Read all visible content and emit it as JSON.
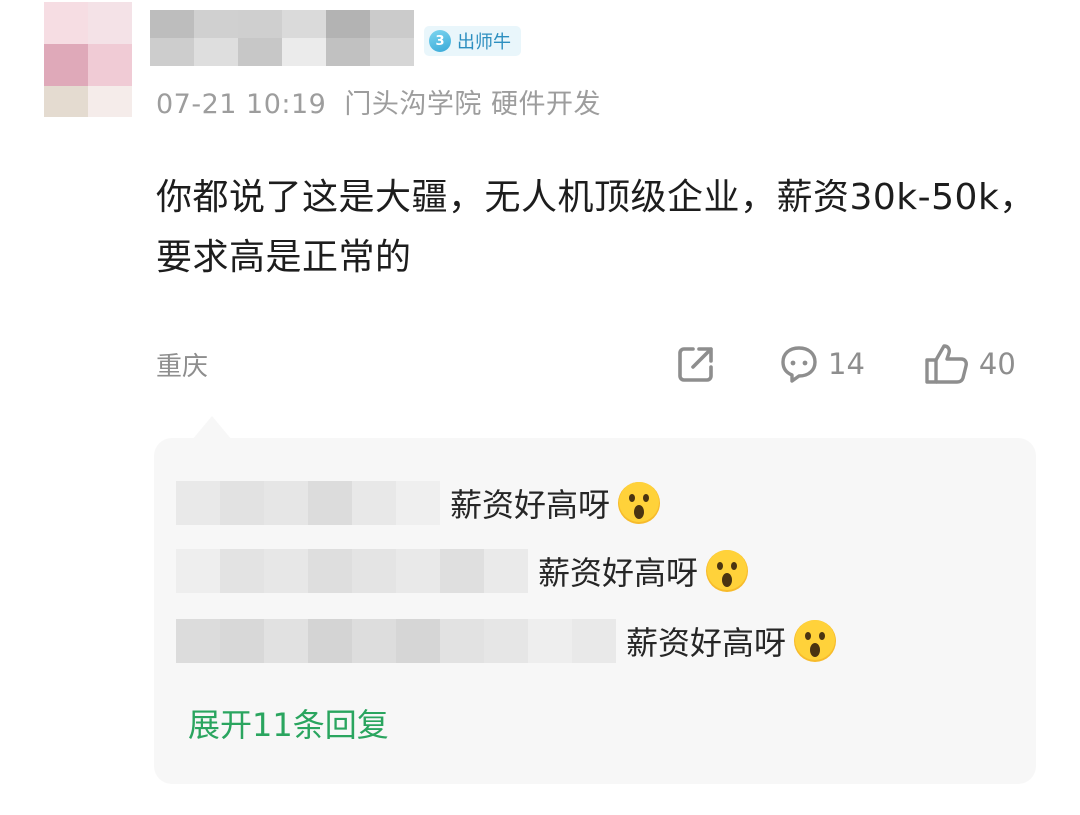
{
  "author": {
    "avatar": {
      "tiles": [
        "#f6dde3",
        "#f4e2e7",
        "#dfa9b9",
        "#f0cbd5",
        "#e4dbd0",
        "#f5ecea"
      ]
    },
    "name_blur_tiles": [
      "#bdbdbd",
      "#d0d0d0",
      "#cfcfcf",
      "#dadada",
      "#b3b3b3",
      "#cbcbcb",
      "#cdcdcd",
      "#dedede",
      "#c7c7c7",
      "#ebebeb",
      "#c1c1c1",
      "#d6d6d6"
    ],
    "badge": {
      "level": "3",
      "label": "出师牛",
      "color": "#2d8fc0"
    }
  },
  "meta": {
    "timestamp": "07-21 10:19",
    "school": "门头沟学院",
    "major": "硬件开发"
  },
  "post": {
    "text": "你都说了这是大疆，无人机顶级企业，薪资30k-50k，要求高是正常的",
    "location": "重庆"
  },
  "actions": {
    "share_icon": "share-icon",
    "comment_icon": "comment-icon",
    "comment_count": "14",
    "like_icon": "thumbs-up-icon",
    "like_count": "40"
  },
  "replies": {
    "items": [
      {
        "name_blur_tiles": [
          "#e9e9e9",
          "#e2e2e2",
          "#e6e6e6",
          "#dcdcdc",
          "#e8e8e8",
          "#efefef"
        ],
        "text": "薪资好高呀",
        "emoji": "astonished-face-emoji"
      },
      {
        "name_blur_tiles": [
          "#eeeeee",
          "#e3e3e3",
          "#e7e7e7",
          "#dedede",
          "#e4e4e4",
          "#e9e9e9",
          "#dfdfdf",
          "#eaeaea"
        ],
        "text": "薪资好高呀",
        "emoji": "astonished-face-emoji"
      },
      {
        "name_blur_tiles": [
          "#dcdcdc",
          "#d8d8d8",
          "#e1e1e1",
          "#d4d4d4",
          "#dddddd",
          "#d6d6d6",
          "#e2e2e2",
          "#e6e6e6",
          "#eeeeee",
          "#e9e9e9"
        ],
        "text": "薪资好高呀",
        "emoji": "astonished-face-emoji"
      }
    ],
    "expand_label": "展开11条回复",
    "accent": "#2aa55f"
  }
}
